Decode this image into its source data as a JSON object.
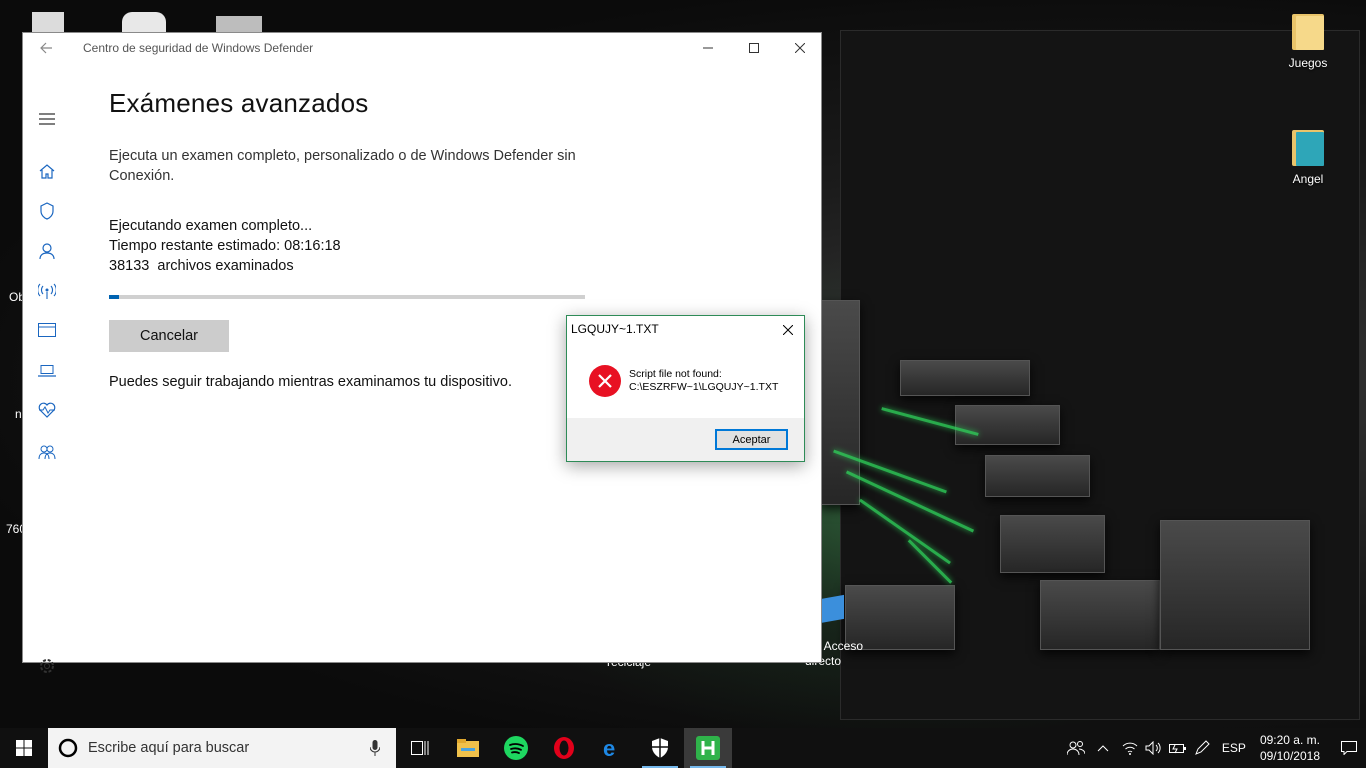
{
  "desktop": {
    "icons": [
      {
        "label": "Juegos",
        "icon": "folder-icon"
      },
      {
        "label": "Angel",
        "icon": "folder-icon"
      }
    ],
    "partial_labels": [
      "Ob",
      "n",
      "760",
      "- Acceso",
      "directo",
      "reciclaje"
    ]
  },
  "defender": {
    "title": "Centro de seguridad de Windows Defender",
    "heading": "Exámenes avanzados",
    "description": "Ejecuta un examen completo, personalizado o de Windows Defender sin Conexión.",
    "status_line": "Ejecutando examen completo...",
    "time_remaining": "Tiempo restante estimado: 08:16:18",
    "files_scanned": "38133  archivos examinados",
    "progress": 0.02,
    "cancel_label": "Cancelar",
    "note": "Puedes seguir trabajando mientras examinamos tu dispositivo.",
    "sidebar": [
      "menu-icon",
      "home-icon",
      "shield-icon",
      "account-icon",
      "network-icon",
      "app-browser-icon",
      "device-icon",
      "health-icon",
      "family-icon",
      "settings-icon"
    ]
  },
  "dialog": {
    "title": "LGQUJY~1.TXT",
    "message_line1": "Script file not found:",
    "message_line2": "C:\\ESZRFW~1\\LGQUJY~1.TXT",
    "ok_label": "Aceptar"
  },
  "taskbar": {
    "search_placeholder": "Escribe aquí para buscar",
    "apps": [
      "task-view-icon",
      "file-explorer-icon",
      "spotify-icon",
      "opera-icon",
      "edge-icon",
      "defender-icon",
      "hma-icon"
    ],
    "language": "ESP",
    "time": "09:20 a. m.",
    "date": "09/10/2018"
  },
  "colors": {
    "accent": "#0063b1",
    "error": "#e81123",
    "dialog_border": "#2e8b57"
  }
}
